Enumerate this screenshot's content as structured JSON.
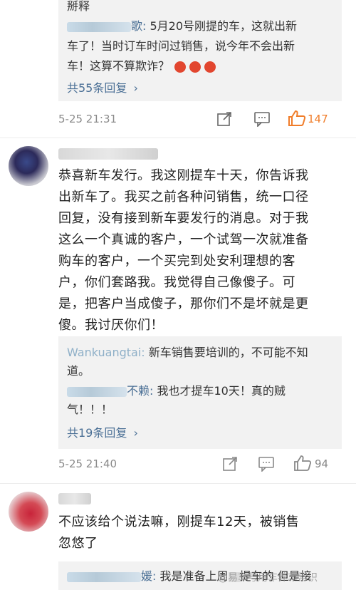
{
  "top_thread": {
    "cut_label": "掰释",
    "reply1": {
      "name_tail": "歌:",
      "text_line1": " 5月20号刚提的车，这就出新",
      "text_line2": "车了！当时订车时问过销售，说今年不会出新",
      "text_line3": "车！这算不算欺诈？"
    },
    "more_replies": "共55条回复",
    "time": "5-25 21:31",
    "likes": "147"
  },
  "comment2": {
    "text_lines": [
      "恭喜新车发行。我这刚提车十天，你告诉我",
      "出新车了。我买之前各种问销售，统一口径",
      "回复，没有接到新车要发行的消息。对于我",
      "这么一个真诚的客户，一个试驾一次就准备",
      "购车的客户，一个买完到处安利理想的客",
      "户，你们套路我。我觉得自己像傻子。可",
      "是，把客户当成傻子，那你们不是坏就是更",
      "傻。我讨厌你们！"
    ],
    "reply1": {
      "name": "Wankuangtai:",
      "text_line1": " 新车销售要培训的，不可能不知",
      "text_line2": "道。"
    },
    "reply2": {
      "name_tail": "不赖:",
      "text_line1": " 我也才提车10天！真的贼",
      "text_line2": "气！！！"
    },
    "more_replies": "共19条回复",
    "time": "5-25 21:40",
    "likes": "94"
  },
  "comment3": {
    "text_lines": [
      "不应该给个说法嘛，刚提车12天，被销售",
      "忽悠了"
    ],
    "reply1": {
      "name_tail": "媛:",
      "text_line1": " 我是准备上周",
      "text_line2": "提车的 但是接"
    }
  },
  "watermark": "@易车号用车养车常识",
  "colors": {
    "link": "#4a6f95",
    "like_active": "#f07d2a",
    "reply_bg": "#f2f2f2"
  }
}
